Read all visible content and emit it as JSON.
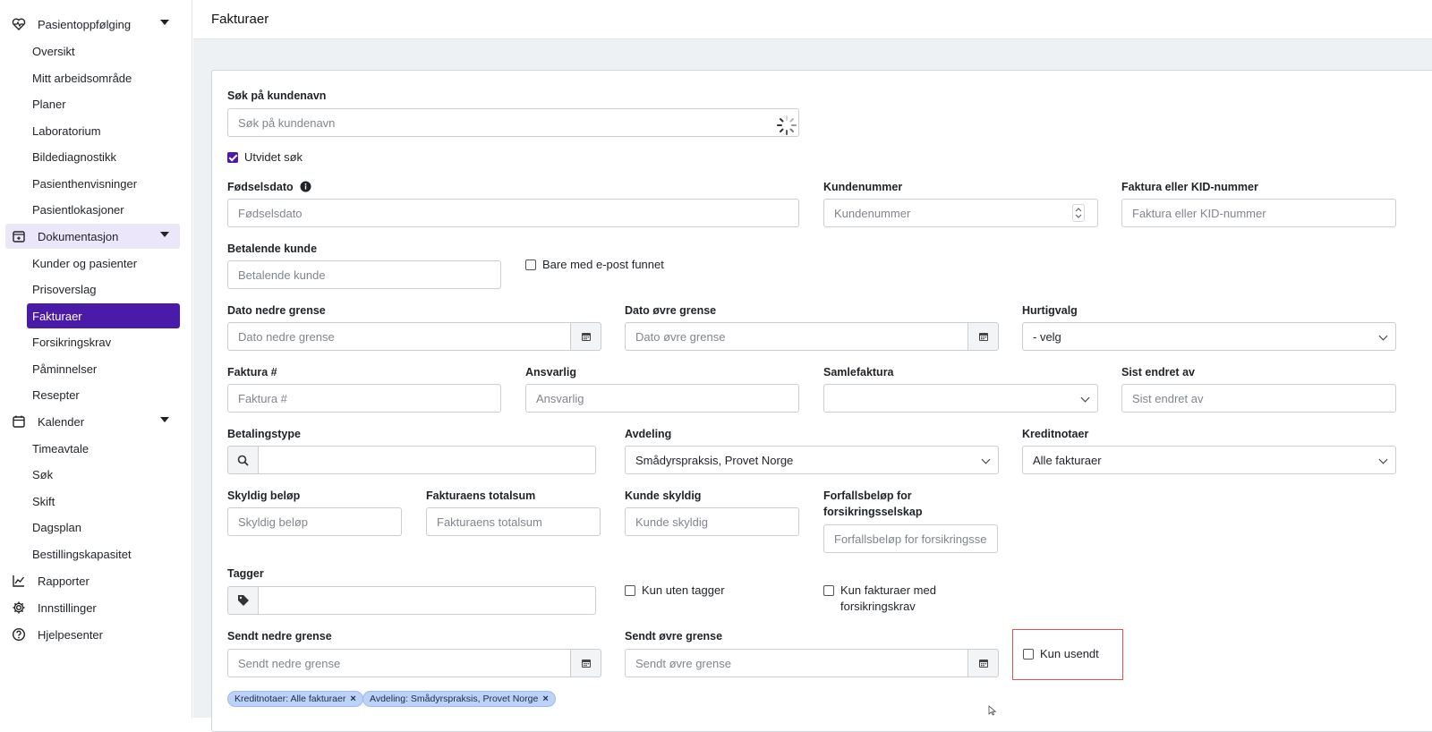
{
  "header": {
    "title": "Fakturaer"
  },
  "sidebar": {
    "groups": [
      {
        "label": "Pasientoppfølging",
        "icon": "heart-pulse-icon",
        "expanded": true,
        "items": [
          "Oversikt",
          "Mitt arbeidsområde",
          "Planer",
          "Laboratorium",
          "Bildediagnostikk",
          "Pasienthenvisninger",
          "Pasientlokasjoner"
        ]
      },
      {
        "label": "Dokumentasjon",
        "icon": "document-icon",
        "expanded": true,
        "active": true,
        "items": [
          "Kunder og pasienter",
          "Prisoverslag",
          "Fakturaer",
          "Forsikringskrav",
          "Påminnelser",
          "Resepter"
        ]
      },
      {
        "label": "Kalender",
        "icon": "calendar-icon",
        "expanded": true,
        "items": [
          "Timeavtale",
          "Søk",
          "Skift",
          "Dagsplan",
          "Bestillingskapasitet"
        ]
      },
      {
        "label": "Rapporter",
        "icon": "chart-line-icon"
      },
      {
        "label": "Innstillinger",
        "icon": "gear-icon"
      },
      {
        "label": "Hjelpesenter",
        "icon": "help-circle-icon"
      }
    ],
    "active_item": "Fakturaer"
  },
  "form": {
    "customer_search": {
      "label": "Søk på kundenavn",
      "placeholder": "Søk på kundenavn"
    },
    "extended_search": {
      "label": "Utvidet søk",
      "checked": true
    },
    "birthdate": {
      "label": "Fødselsdato",
      "placeholder": "Fødselsdato"
    },
    "customer_number": {
      "label": "Kundenummer",
      "placeholder": "Kundenummer"
    },
    "invoice_kid": {
      "label": "Faktura eller KID-nummer",
      "placeholder": "Faktura eller KID-nummer"
    },
    "paying_customer": {
      "label": "Betalende kunde",
      "placeholder": "Betalende kunde"
    },
    "only_email": {
      "label": "Bare med e-post funnet",
      "checked": false
    },
    "date_lower": {
      "label": "Dato nedre grense",
      "placeholder": "Dato nedre grense"
    },
    "date_upper": {
      "label": "Dato øvre grense",
      "placeholder": "Dato øvre grense"
    },
    "quick_select": {
      "label": "Hurtigvalg",
      "value": "- velg"
    },
    "invoice_no": {
      "label": "Faktura #",
      "placeholder": "Faktura #"
    },
    "responsible": {
      "label": "Ansvarlig",
      "placeholder": "Ansvarlig"
    },
    "collective_invoice": {
      "label": "Samlefaktura",
      "value": ""
    },
    "last_changed_by": {
      "label": "Sist endret av",
      "placeholder": "Sist endret av"
    },
    "payment_type": {
      "label": "Betalingstype"
    },
    "department": {
      "label": "Avdeling",
      "value": "Smådyrspraksis, Provet Norge"
    },
    "credit_notes": {
      "label": "Kreditnotaer",
      "value": "Alle fakturaer"
    },
    "amount_due": {
      "label": "Skyldig beløp",
      "placeholder": "Skyldig beløp"
    },
    "invoice_total": {
      "label": "Fakturaens totalsum",
      "placeholder": "Fakturaens totalsum"
    },
    "customer_owes": {
      "label": "Kunde skyldig",
      "placeholder": "Kunde skyldig"
    },
    "insurer_due_line1": "Forfallsbeløp for",
    "insurer_due_line2": "forsikringsselskap",
    "insurer_due_placeholder": "Forfallsbeløp for forsikringsselskap",
    "tags": {
      "label": "Tagger"
    },
    "only_without_tags": {
      "label": "Kun uten tagger",
      "checked": false
    },
    "only_insurance_line1": "Kun fakturaer med",
    "only_insurance_line2": "forsikringskrav",
    "sent_lower": {
      "label": "Sendt nedre grense",
      "placeholder": "Sendt nedre grense"
    },
    "sent_upper": {
      "label": "Sendt øvre grense",
      "placeholder": "Sendt øvre grense"
    },
    "only_unsent": {
      "label": "Kun usendt",
      "checked": false
    }
  },
  "filters": [
    {
      "label": "Kreditnotaer: Alle fakturaer"
    },
    {
      "label": "Avdeling: Smådyrspraksis, Provet Norge"
    }
  ],
  "colors": {
    "accent": "#4a1aa8",
    "active_group_bg": "#ece6fb",
    "chip_bg": "#bcd2f7",
    "highlight": "#e0524d"
  }
}
